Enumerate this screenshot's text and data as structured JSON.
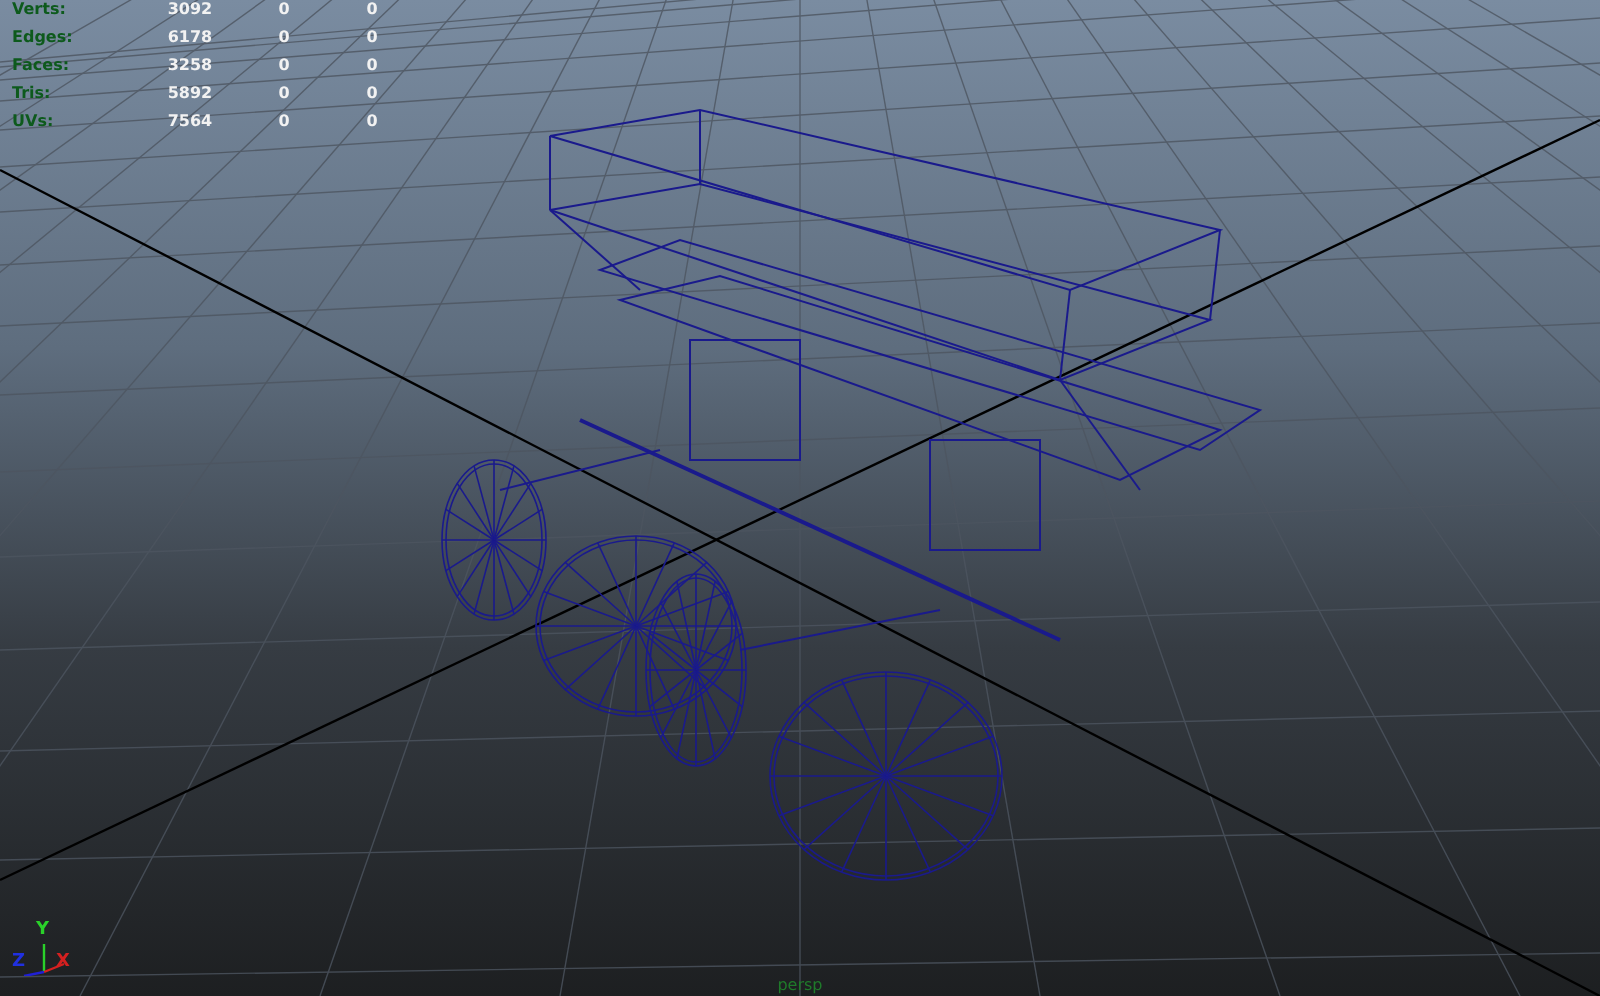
{
  "hud": {
    "rows": [
      {
        "label": "Verts:",
        "values": [
          "3092",
          "0",
          "0"
        ]
      },
      {
        "label": "Edges:",
        "values": [
          "6178",
          "0",
          "0"
        ]
      },
      {
        "label": "Faces:",
        "values": [
          "3258",
          "0",
          "0"
        ]
      },
      {
        "label": "Tris:",
        "values": [
          "5892",
          "0",
          "0"
        ]
      },
      {
        "label": "UVs:",
        "values": [
          "7564",
          "0",
          "0"
        ]
      }
    ]
  },
  "axis_gizmo": {
    "y": "Y",
    "z": "Z",
    "x": "X"
  },
  "camera_label": "persp"
}
